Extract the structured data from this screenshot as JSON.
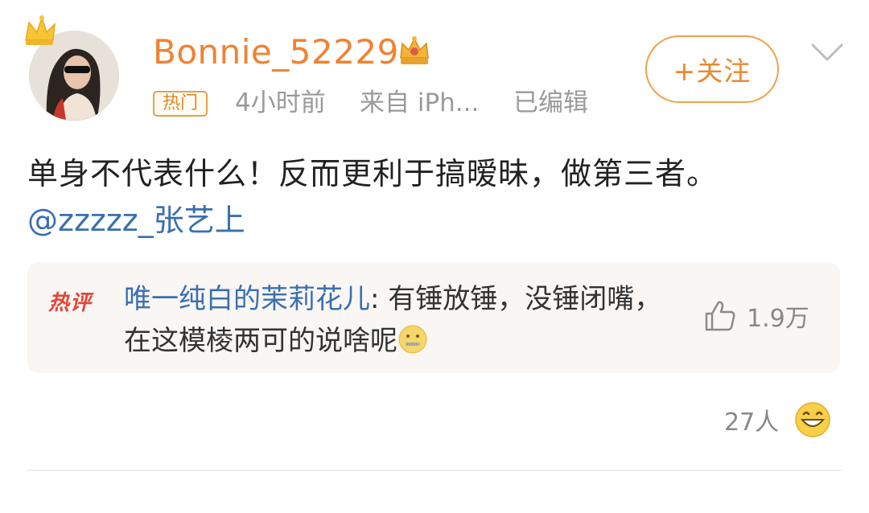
{
  "post": {
    "username": "Bonnie_52229",
    "hot_tag": "热门",
    "time": "4小时前",
    "source": "来自 iPh...",
    "edited": "已编辑",
    "follow_label": "+关注",
    "text": "单身不代表什么！反而更利于搞暧昧，做第三者。",
    "mention": "@zzzzz_张艺上"
  },
  "hot_comment": {
    "label": "热评",
    "commenter": "唯一纯白的茉莉花儿",
    "separator": ": ",
    "text": "有锤放锤，没锤闭嘴，在这模棱两可的说啥呢",
    "emoji": "zipper-mouth-face-icon",
    "likes": "1.9万"
  },
  "reactions": {
    "count": "27人",
    "emoji": "grinning-face-icon"
  },
  "action_bar": {
    "repost_label": "",
    "comment_label": "",
    "like_label": ""
  },
  "colors": {
    "username": "#f08232",
    "link": "#3a6fb0",
    "follow": "#e8892f",
    "hot_label": "#e0473a",
    "meta": "#9a9a9a"
  }
}
